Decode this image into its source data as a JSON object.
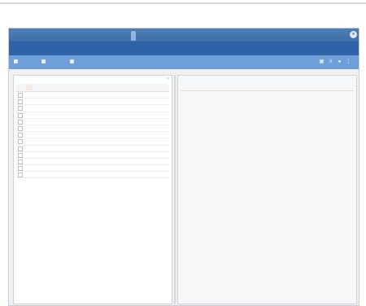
{
  "page": {
    "title": ""
  },
  "window": {
    "tabs": [
      {
        "label": ""
      },
      {
        "label": ""
      },
      {
        "label": ""
      },
      {
        "label": ""
      },
      {
        "label": ""
      }
    ],
    "header_text": "",
    "toolbar": {
      "items": [
        {
          "label": "",
          "icon": "refresh-icon"
        },
        {
          "label": "",
          "icon": "settings-icon"
        },
        {
          "label": "",
          "icon": "document-icon"
        }
      ],
      "right_icons": [
        "grid-icon",
        "list-icon",
        "pin-icon",
        "more-icon"
      ]
    },
    "colors": {
      "tabstrip": "#3d6ea7",
      "header_bar": "#2f63a8",
      "toolbar": "#6f9fd8"
    }
  },
  "left_pane": {
    "title": "",
    "columns": {
      "a": "",
      "b": ""
    },
    "rows": [
      {
        "name": "",
        "value": ""
      },
      {
        "name": "",
        "value": ""
      },
      {
        "name": "",
        "value": ""
      },
      {
        "name": "",
        "value": ""
      },
      {
        "name": "",
        "value": ""
      },
      {
        "name": "",
        "value": ""
      },
      {
        "name": "",
        "value": ""
      },
      {
        "name": "",
        "value": ""
      },
      {
        "name": "",
        "value": ""
      },
      {
        "name": "",
        "value": ""
      },
      {
        "name": "",
        "value": ""
      },
      {
        "name": "",
        "value": ""
      },
      {
        "name": "",
        "value": ""
      }
    ]
  },
  "right_pane": {
    "title": "",
    "column": "",
    "empty_message": ""
  },
  "gutter_mark": ""
}
